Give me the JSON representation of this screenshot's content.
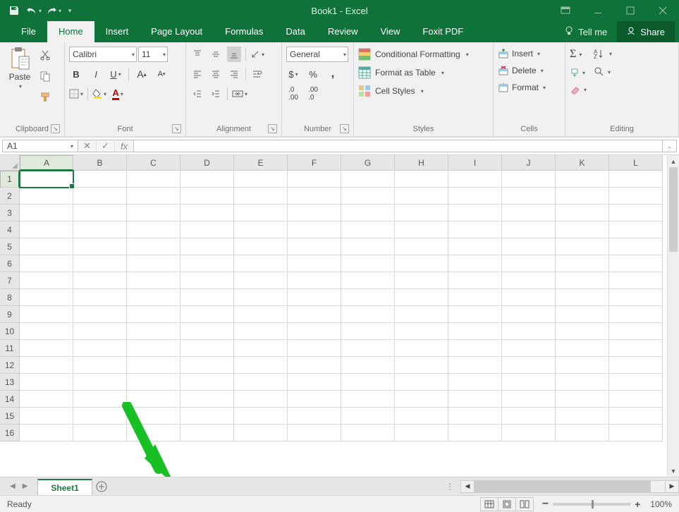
{
  "title": "Book1  -  Excel",
  "qat": {
    "save": "save",
    "undo": "undo",
    "redo": "redo",
    "customize": "customize"
  },
  "tabs": [
    "File",
    "Home",
    "Insert",
    "Page Layout",
    "Formulas",
    "Data",
    "Review",
    "View",
    "Foxit PDF"
  ],
  "active_tab": "Home",
  "tellme": "Tell me",
  "share": "Share",
  "ribbon": {
    "clipboard": {
      "paste": "Paste",
      "label": "Clipboard"
    },
    "font": {
      "name": "Calibri",
      "size": "11",
      "label": "Font"
    },
    "alignment": {
      "label": "Alignment"
    },
    "number": {
      "format": "General",
      "label": "Number"
    },
    "styles": {
      "cond": "Conditional Formatting",
      "table": "Format as Table",
      "cell": "Cell Styles",
      "label": "Styles"
    },
    "cells": {
      "insert": "Insert",
      "delete": "Delete",
      "format": "Format",
      "label": "Cells"
    },
    "editing": {
      "label": "Editing"
    }
  },
  "namebox": "A1",
  "columns": [
    "A",
    "B",
    "C",
    "D",
    "E",
    "F",
    "G",
    "H",
    "I",
    "J",
    "K",
    "L"
  ],
  "rows": [
    "1",
    "2",
    "3",
    "4",
    "5",
    "6",
    "7",
    "8",
    "9",
    "10",
    "11",
    "12",
    "13",
    "14",
    "15",
    "16"
  ],
  "sheet_tab": "Sheet1",
  "status": "Ready",
  "zoom": "100%"
}
